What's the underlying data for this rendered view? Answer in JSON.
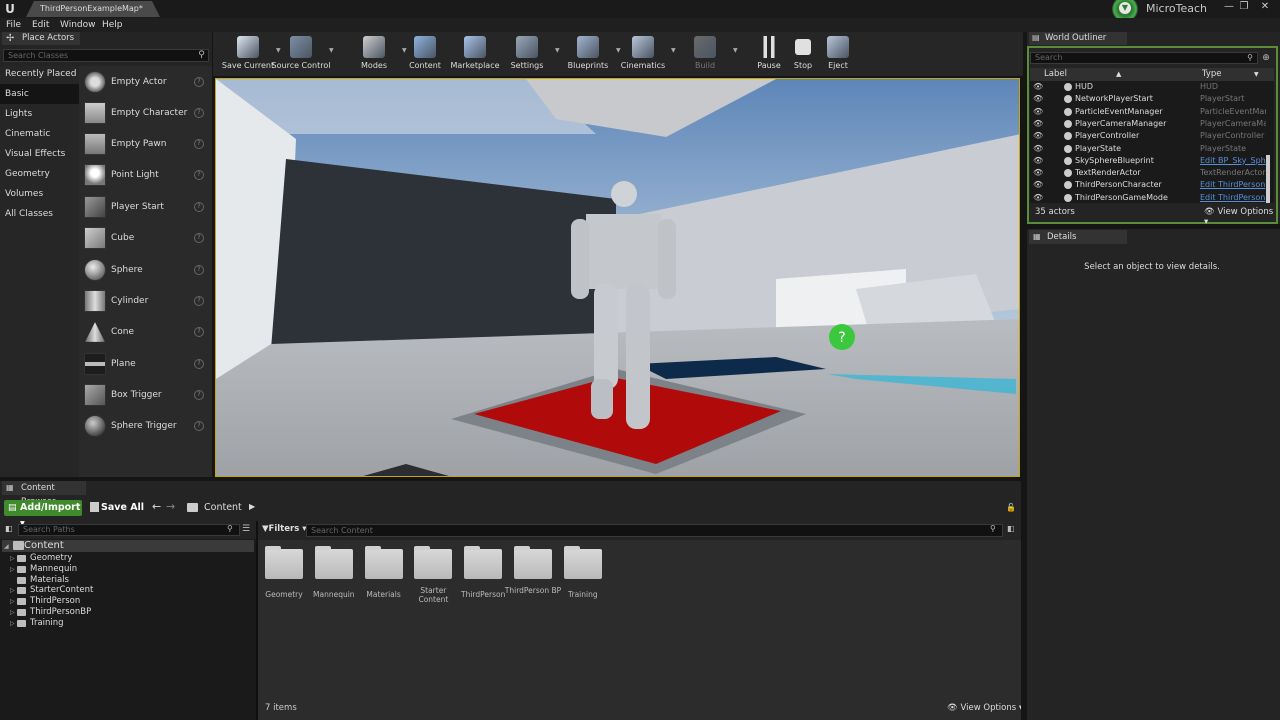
{
  "window": {
    "tab_title": "ThirdPersonExampleMap*",
    "brand": "MicroTeach",
    "controls": [
      "—",
      "❐",
      "✕"
    ]
  },
  "menu": [
    "File",
    "Edit",
    "Window",
    "Help"
  ],
  "place_actors": {
    "tab_label": "Place Actors",
    "search_placeholder": "Search Classes",
    "categories": [
      "Recently Placed",
      "Basic",
      "Lights",
      "Cinematic",
      "Visual Effects",
      "Geometry",
      "Volumes",
      "All Classes"
    ],
    "active_category": "Basic",
    "actors": [
      "Empty Actor",
      "Empty Character",
      "Empty Pawn",
      "Point Light",
      "Player Start",
      "Cube",
      "Sphere",
      "Cylinder",
      "Cone",
      "Plane",
      "Box Trigger",
      "Sphere Trigger"
    ]
  },
  "toolbar": {
    "items": [
      {
        "label": "Save Current",
        "color": "#dfe6ee"
      },
      {
        "label": "Source Control",
        "color": "#7d8fa3"
      },
      {
        "label": "Modes",
        "color": "#cfcfcf"
      },
      {
        "label": "Content",
        "color": "#8fb3e0"
      },
      {
        "label": "Marketplace",
        "color": "#a9c3e8"
      },
      {
        "label": "Settings",
        "color": "#9aa7b8"
      },
      {
        "label": "Blueprints",
        "color": "#a2b6d0"
      },
      {
        "label": "Cinematics",
        "color": "#b8c6d8"
      },
      {
        "label": "Build",
        "color": "#6a6a6a"
      },
      {
        "label": "Pause",
        "color": "#e0e0e0"
      },
      {
        "label": "Stop",
        "color": "#e0e0e0"
      },
      {
        "label": "Eject",
        "color": "#b8c6d8"
      }
    ]
  },
  "outliner": {
    "tab_label": "World Outliner",
    "search_placeholder": "Search",
    "col_label": "Label",
    "col_type": "Type",
    "rows": [
      {
        "label": "HUD",
        "type": "HUD",
        "link": false
      },
      {
        "label": "NetworkPlayerStart",
        "type": "PlayerStart",
        "link": false
      },
      {
        "label": "ParticleEventManager",
        "type": "ParticleEventMan",
        "link": false
      },
      {
        "label": "PlayerCameraManager",
        "type": "PlayerCameraMan",
        "link": false
      },
      {
        "label": "PlayerController",
        "type": "PlayerController",
        "link": false
      },
      {
        "label": "PlayerState",
        "type": "PlayerState",
        "link": false
      },
      {
        "label": "SkySphereBlueprint",
        "type": "Edit BP_Sky_Sph",
        "link": true
      },
      {
        "label": "TextRenderActor",
        "type": "TextRenderActor",
        "link": false
      },
      {
        "label": "ThirdPersonCharacter",
        "type": "Edit ThirdPerson",
        "link": true
      },
      {
        "label": "ThirdPersonGameMode",
        "type": "Edit ThirdPerson",
        "link": true
      }
    ],
    "actor_count": "35 actors",
    "view_options": "View Options"
  },
  "details": {
    "tab_label": "Details",
    "empty_message": "Select an object to view details."
  },
  "content_browser": {
    "tab_label": "Content Browser",
    "add_import": "Add/Import",
    "save_all": "Save All",
    "breadcrumb": "Content",
    "paths_placeholder": "Search Paths",
    "filters": "Filters",
    "content_placeholder": "Search Content",
    "tree_root": "Content",
    "tree_children": [
      "Geometry",
      "Mannequin",
      "Materials",
      "StarterContent",
      "ThirdPerson",
      "ThirdPersonBP",
      "Training"
    ],
    "assets": [
      "Geometry",
      "Mannequin",
      "Materials",
      "Starter Content",
      "ThirdPerson",
      "ThirdPerson BP",
      "Training"
    ],
    "item_count": "7 items",
    "view_options": "View Options"
  },
  "viewport": {
    "highlight_color": "#caa400",
    "platform_color": "#b00a0a"
  }
}
